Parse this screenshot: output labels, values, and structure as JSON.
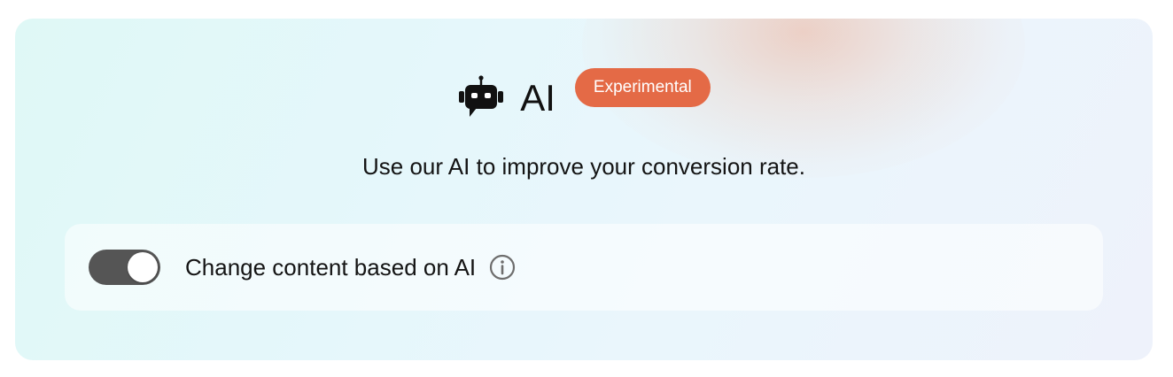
{
  "header": {
    "icon": "robot-icon",
    "title": "AI",
    "badge": "Experimental"
  },
  "subtitle": "Use our AI to improve your conversion rate.",
  "option": {
    "toggle_on": true,
    "label": "Change content based on AI",
    "info_icon": "info-icon"
  },
  "colors": {
    "badge": "#e46a46",
    "toggle_track": "#555555",
    "text": "#141414"
  }
}
